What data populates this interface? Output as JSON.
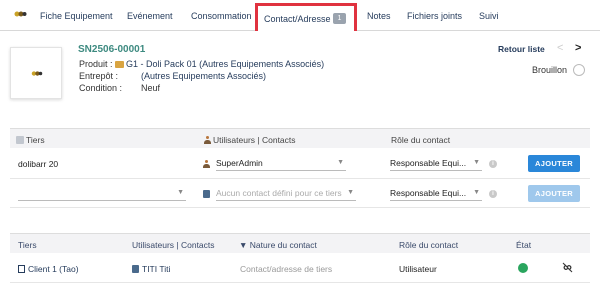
{
  "tabs": {
    "items": [
      {
        "label": "Fiche Equipement"
      },
      {
        "label": "Evénement"
      },
      {
        "label": "Consommation"
      },
      {
        "label": "Contact/Adresse",
        "badge": "1",
        "active": true
      },
      {
        "label": "Notes"
      },
      {
        "label": "Fichiers joints"
      },
      {
        "label": "Suivi"
      }
    ]
  },
  "banner": {
    "ref": "SN2506-00001",
    "product_label": "Produit :",
    "product_value": "G1 - Doli Pack 01 (Autres Equipements Associés)",
    "warehouse_label": "Entrepôt :",
    "warehouse_value": "(Autres Equipements Associés)",
    "condition_label": "Condition :",
    "condition_value": "Neuf",
    "back_link": "Retour liste",
    "prev": "<",
    "next": ">",
    "status": "Brouillon"
  },
  "add_table": {
    "headers": {
      "tiers": "Tiers",
      "users": "Utilisateurs | Contacts",
      "role": "Rôle du contact"
    },
    "row1": {
      "tiers": "dolibarr 20",
      "user": "SuperAdmin",
      "role": "Responsable Equi...",
      "button": "AJOUTER"
    },
    "row2": {
      "tiers": "",
      "contact_placeholder": "Aucun contact défini pour ce tiers",
      "role": "Responsable Equi...",
      "button": "AJOUTER"
    }
  },
  "list_table": {
    "headers": {
      "tiers": "Tiers",
      "users": "Utilisateurs | Contacts",
      "nature": "Nature du contact",
      "role": "Rôle du contact",
      "state": "État"
    },
    "rows": [
      {
        "tiers": "Client 1 (Tao)",
        "contact": "TITI Titi",
        "nature": "Contact/adresse de tiers",
        "role": "Utilisateur",
        "state": "active"
      }
    ]
  },
  "colors": {
    "accent": "#2a87d9",
    "highlight": "#e0323f",
    "ref": "#3d8a80",
    "status_active": "#2aa55e"
  }
}
